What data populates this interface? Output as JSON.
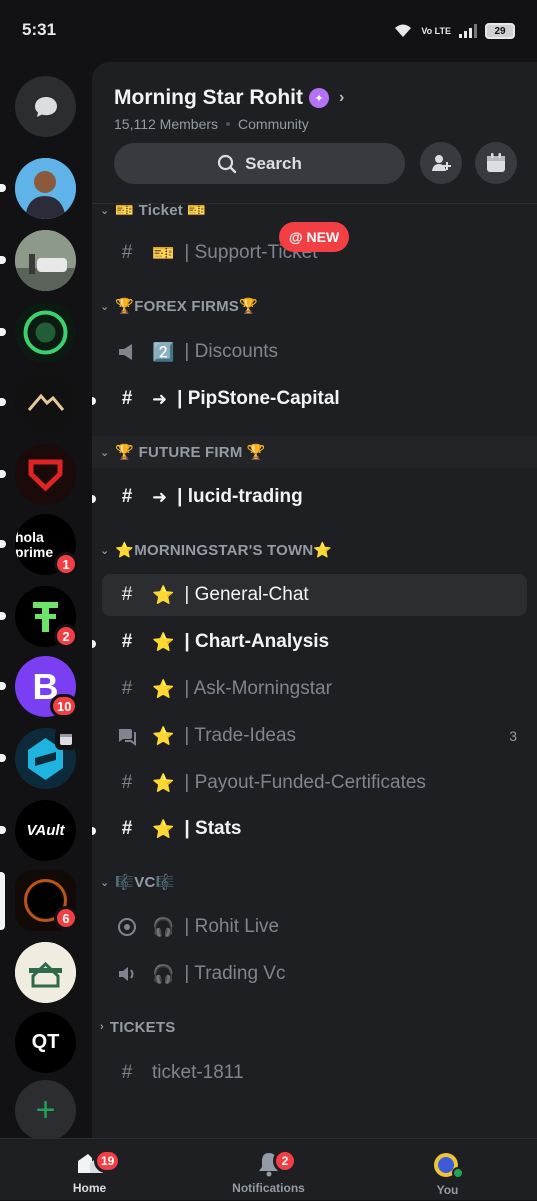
{
  "status_bar": {
    "time": "5:31",
    "network": "Vo LTE",
    "battery": "29"
  },
  "rail": {
    "servers": [
      {
        "name": "profile-server",
        "badge": ""
      },
      {
        "name": "bmw-server",
        "badge": ""
      },
      {
        "name": "green-ring-server",
        "badge": ""
      },
      {
        "name": "mountain-server",
        "badge": ""
      },
      {
        "name": "red-shield-server",
        "badge": ""
      },
      {
        "name": "hola-prime-server",
        "label": "hola prime",
        "badge": "1"
      },
      {
        "name": "green-logo-server",
        "badge": "2"
      },
      {
        "name": "purple-b-server",
        "label": "B",
        "badge": "10"
      },
      {
        "name": "blue-crystal-server",
        "badge": ""
      },
      {
        "name": "vault-server",
        "label": "VAult",
        "badge": ""
      },
      {
        "name": "morning-star-server",
        "badge": "6"
      },
      {
        "name": "house-server",
        "badge": ""
      },
      {
        "name": "qt-server",
        "label": "QT",
        "badge": ""
      }
    ]
  },
  "server": {
    "name": "Morning Star Rohit",
    "members": "15,112 Members",
    "type": "Community",
    "search_label": "Search"
  },
  "channels": {
    "ticket_cat": "🎫 Ticket 🎫",
    "support_ticket": {
      "emoji": "🎫",
      "name": "| Support-Ticket"
    },
    "new_badge": "@ NEW",
    "forex_cat": "🏆FOREX FIRMS🏆",
    "discounts": {
      "emoji": "2️⃣",
      "name": "| Discounts"
    },
    "pipstone": {
      "emoji": "➜",
      "name": "| PipStone-Capital"
    },
    "future_cat": "🏆 FUTURE FIRM 🏆",
    "lucid": {
      "emoji": "➜",
      "name": "| lucid-trading"
    },
    "town_cat": "⭐MORNINGSTAR'S TOWN⭐",
    "general": {
      "emoji": "⭐",
      "name": "| General-Chat"
    },
    "chart": {
      "emoji": "⭐",
      "name": "| Chart-Analysis"
    },
    "ask": {
      "emoji": "⭐",
      "name": "| Ask-Morningstar"
    },
    "trade": {
      "emoji": "⭐",
      "name": "| Trade-Ideas",
      "count": "3"
    },
    "payout": {
      "emoji": "⭐",
      "name": "| Payout-Funded-Certificates"
    },
    "stats": {
      "emoji": "⭐",
      "name": "| Stats"
    },
    "vc_cat": "🎼VC🎼",
    "rohit_live": {
      "emoji": "🎧",
      "name": "| Rohit Live"
    },
    "trading_vc": {
      "emoji": "🎧",
      "name": "| Trading Vc"
    },
    "tickets_cat": "TICKETS",
    "ticket_1811": {
      "name": "ticket-1811"
    }
  },
  "bottom_nav": {
    "home": {
      "label": "Home",
      "badge": "19"
    },
    "notifications": {
      "label": "Notifications",
      "badge": "2"
    },
    "you": {
      "label": "You"
    }
  },
  "colors": {
    "accent_red": "#f23f43",
    "online_green": "#23a559",
    "boost_purple": "#b473f5"
  }
}
